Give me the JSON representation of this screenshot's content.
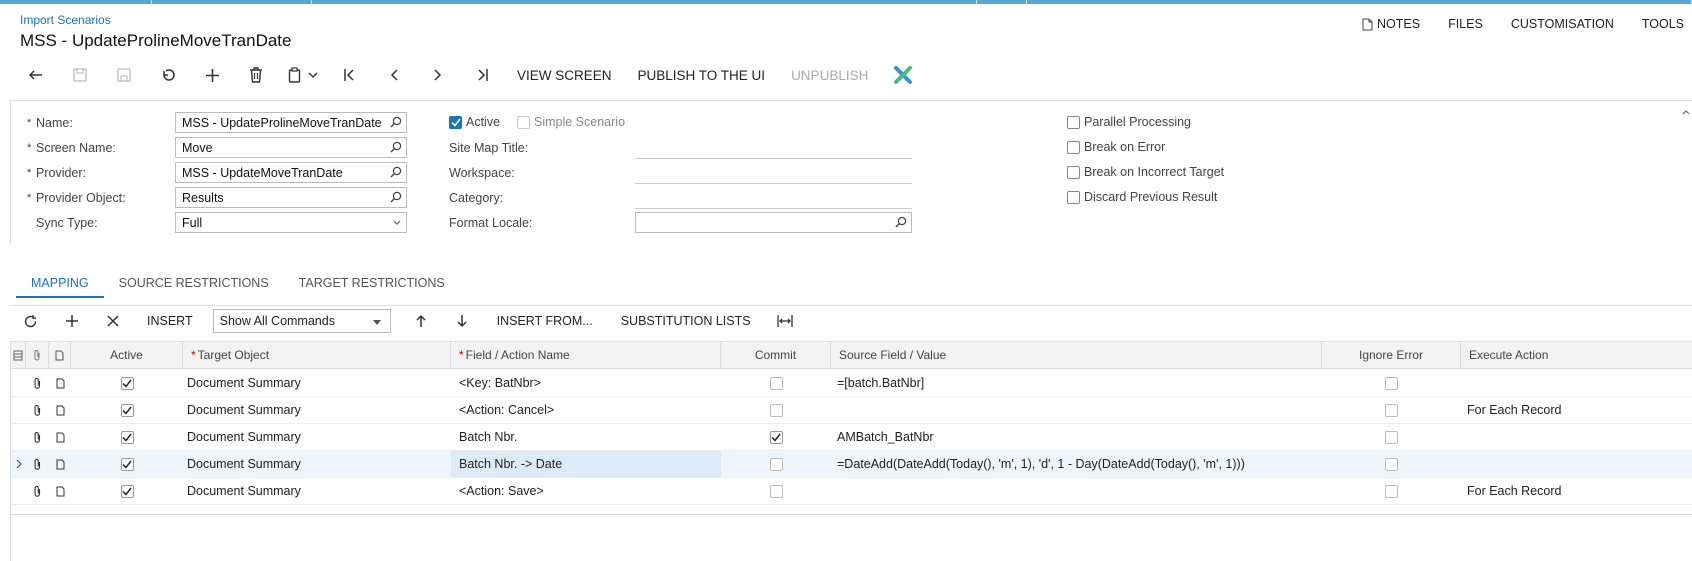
{
  "header": {
    "breadcrumb": "Import Scenarios",
    "title": "MSS - UpdateProlineMoveTranDate",
    "links": [
      "NOTES",
      "FILES",
      "CUSTOMISATION",
      "TOOLS"
    ]
  },
  "toolbar": {
    "view_screen": "VIEW SCREEN",
    "publish": "PUBLISH TO THE UI",
    "unpublish": "UNPUBLISH"
  },
  "form": {
    "name_label": "Name:",
    "name_value": "MSS - UpdateProlineMoveTranDate",
    "screen_label": "Screen Name:",
    "screen_value": "Move",
    "provider_label": "Provider:",
    "provider_value": "MSS - UpdateMoveTranDate",
    "provider_object_label": "Provider Object:",
    "provider_object_value": "Results",
    "sync_label": "Sync Type:",
    "sync_value": "Full",
    "active_label": "Active",
    "simple_label": "Simple Scenario",
    "sitemap_label": "Site Map Title:",
    "workspace_label": "Workspace:",
    "category_label": "Category:",
    "locale_label": "Format Locale:",
    "parallel_label": "Parallel Processing",
    "break_error_label": "Break on Error",
    "break_target_label": "Break on Incorrect Target",
    "discard_label": "Discard Previous Result"
  },
  "tabs": [
    "MAPPING",
    "SOURCE RESTRICTIONS",
    "TARGET RESTRICTIONS"
  ],
  "grid_toolbar": {
    "insert": "INSERT",
    "show_commands": "Show All Commands",
    "insert_from": "INSERT FROM...",
    "substitution": "SUBSTITUTION LISTS"
  },
  "grid": {
    "headers": {
      "active": "Active",
      "target_object": "Target Object",
      "field_action": "Field / Action Name",
      "commit": "Commit",
      "source_field": "Source Field / Value",
      "ignore_error": "Ignore Error",
      "execute_action": "Execute Action"
    },
    "rows": [
      {
        "target": "Document Summary",
        "field": "<Key: BatNbr>",
        "commit": false,
        "source": "=[batch.BatNbr]",
        "execute": ""
      },
      {
        "target": "Document Summary",
        "field": "<Action: Cancel>",
        "commit": false,
        "source": "",
        "execute": "For Each Record"
      },
      {
        "target": "Document Summary",
        "field": "Batch Nbr.",
        "commit": true,
        "source": "AMBatch_BatNbr",
        "execute": ""
      },
      {
        "target": "Document Summary",
        "field": "Batch Nbr. -> Date",
        "commit": false,
        "source": "=DateAdd(DateAdd(Today(), 'm', 1), 'd', 1 - Day(DateAdd(Today(), 'm', 1)))",
        "execute": ""
      },
      {
        "target": "Document Summary",
        "field": "<Action: Save>",
        "commit": false,
        "source": "",
        "execute": "For Each Record"
      }
    ]
  },
  "colors": {
    "accent": "#1a73b8"
  }
}
